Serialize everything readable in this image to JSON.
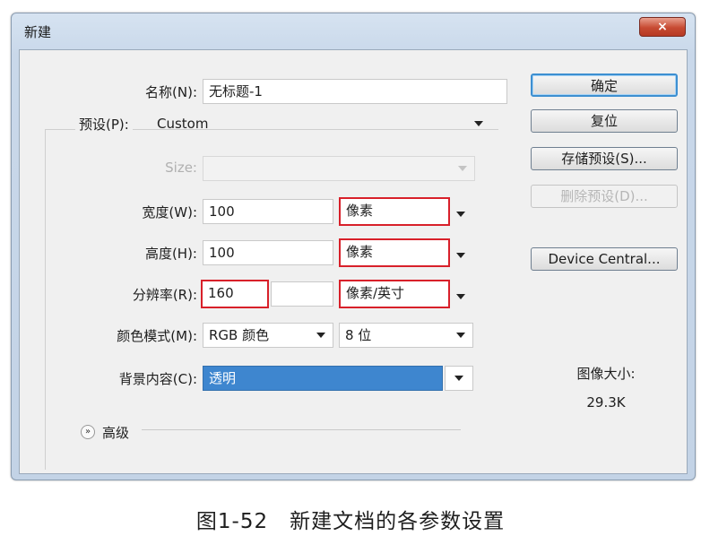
{
  "window": {
    "title": "新建",
    "close_glyph": "×"
  },
  "form": {
    "name_label": "名称(N):",
    "name_value": "无标题-1",
    "preset_label": "预设(P):",
    "preset_value": "Custom",
    "size_label": "Size:",
    "size_value": "",
    "width_label": "宽度(W):",
    "width_value": "100",
    "width_unit": "像素",
    "height_label": "高度(H):",
    "height_value": "100",
    "height_unit": "像素",
    "resolution_label": "分辨率(R):",
    "resolution_value": "160",
    "resolution_unit": "像素/英寸",
    "color_mode_label": "颜色模式(M):",
    "color_mode_value": "RGB 颜色",
    "bit_depth_value": "8 位",
    "background_label": "背景内容(C):",
    "background_value": "透明",
    "advanced_label": "高级"
  },
  "buttons": {
    "ok": "确定",
    "reset": "复位",
    "save_preset": "存储预设(S)...",
    "delete_preset": "删除预设(D)...",
    "device_central": "Device Central..."
  },
  "image_size": {
    "label": "图像大小:",
    "value": "29.3K"
  },
  "caption": "图1-52　新建文档的各参数设置",
  "colors": {
    "highlight_red": "#d8202a",
    "selected_blue": "#3e86cf",
    "default_button_border": "#3d8fd1"
  },
  "icons": [
    "close-icon",
    "dropdown-arrow-icon",
    "chevron-double-down-icon"
  ]
}
